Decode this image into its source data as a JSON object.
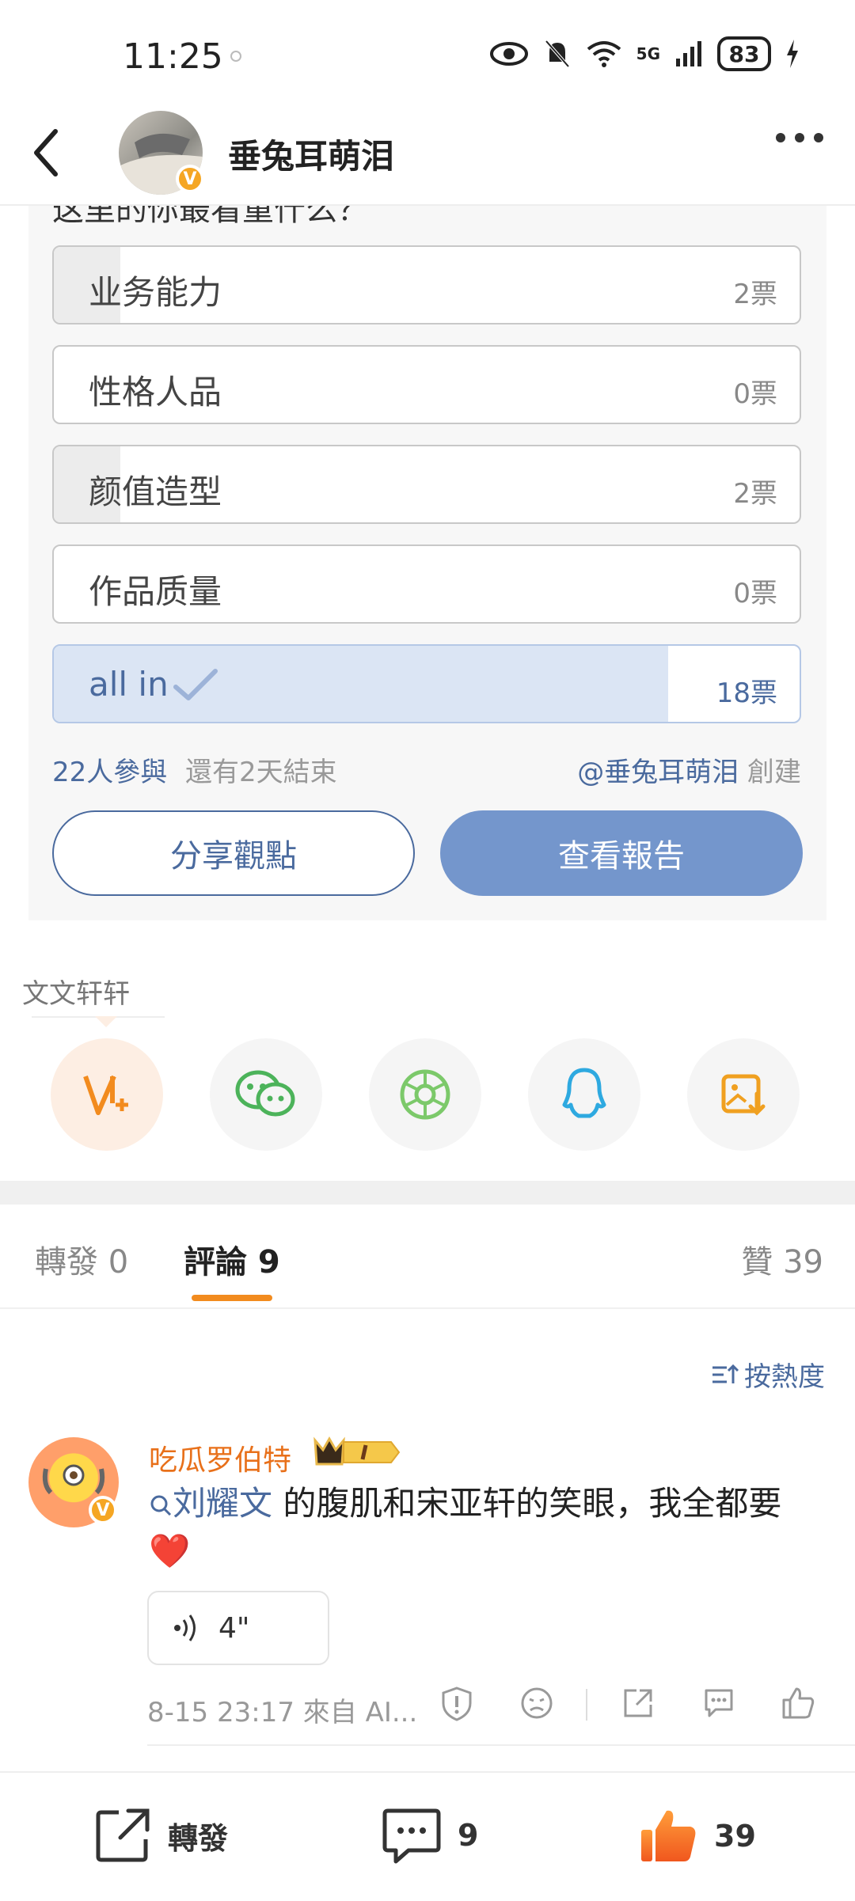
{
  "status_bar": {
    "time": "11:25",
    "signal": "5G",
    "battery": "83"
  },
  "header": {
    "title": "垂兔耳萌泪"
  },
  "poll": {
    "question_partial": "这里的你最看重什么？",
    "options": [
      {
        "label": "业务能力",
        "votes": "2票",
        "fraction": 0.09
      },
      {
        "label": "性格人品",
        "votes": "0票",
        "fraction": 0.0
      },
      {
        "label": "颜值造型",
        "votes": "2票",
        "fraction": 0.09
      },
      {
        "label": "作品质量",
        "votes": "0票",
        "fraction": 0.0
      },
      {
        "label": "all in",
        "votes": "18票",
        "fraction": 0.82,
        "selected": true
      }
    ],
    "participants": "22人參與",
    "remaining": "還有2天結束",
    "creator": "@垂兔耳萌泪",
    "created_suffix": "創建",
    "share_label": "分享觀點",
    "report_label": "查看報告"
  },
  "share_row": {
    "user": "文文轩轩",
    "icons": [
      "weibo-vplus-icon",
      "wechat-icon",
      "moments-icon",
      "qq-icon",
      "save-image-icon"
    ]
  },
  "tabs": {
    "repost": "轉發 0",
    "comments": "評論 9",
    "likes": "贊 39"
  },
  "sort": {
    "label": "按熱度"
  },
  "comment": {
    "user": "吃瓜罗伯特",
    "mention": "刘耀文",
    "text": " 的腹肌和宋亚轩的笑眼，我全都要❤️",
    "voice_duration": "4\"",
    "meta": "8-15 23:17  來自 AI..."
  },
  "bottom_bar": {
    "repost": "轉發",
    "comments": "9",
    "likes": "39"
  },
  "colors": {
    "accent_orange": "#f28b1e",
    "link_blue": "#4a6a9e",
    "button_blue": "#7496cc"
  }
}
